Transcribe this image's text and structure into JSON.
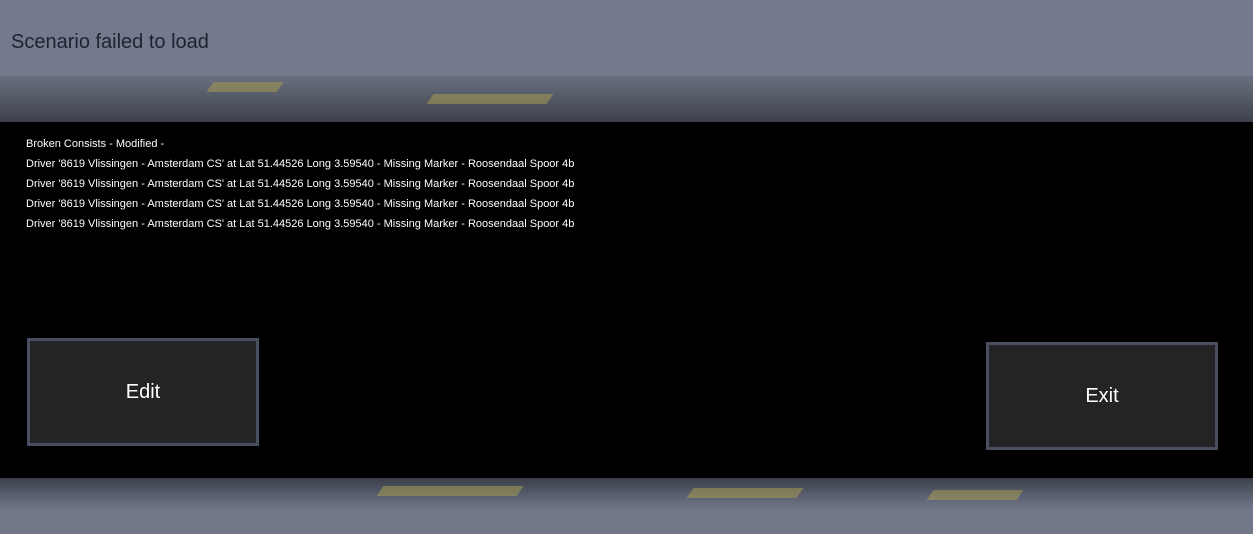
{
  "window": {
    "title": "Scenario failed to load"
  },
  "errors": {
    "heading": "Broken Consists - Modified -",
    "lines": [
      "Driver '8619 Vlissingen - Amsterdam CS' at Lat 51.44526 Long 3.59540 - Missing Marker - Roosendaal Spoor 4b",
      "Driver '8619 Vlissingen - Amsterdam CS' at Lat 51.44526 Long 3.59540 - Missing Marker - Roosendaal Spoor 4b",
      "Driver '8619 Vlissingen - Amsterdam CS' at Lat 51.44526 Long 3.59540 - Missing Marker - Roosendaal Spoor 4b",
      "Driver '8619 Vlissingen - Amsterdam CS' at Lat 51.44526 Long 3.59540 - Missing Marker - Roosendaal Spoor 4b"
    ]
  },
  "buttons": {
    "edit_label": "Edit",
    "exit_label": "Exit"
  },
  "colors": {
    "overlay": "#717789",
    "panel": "#000000",
    "button_fill": "#242424",
    "button_border": "#4a4f5f",
    "title_text": "#1e2130"
  }
}
